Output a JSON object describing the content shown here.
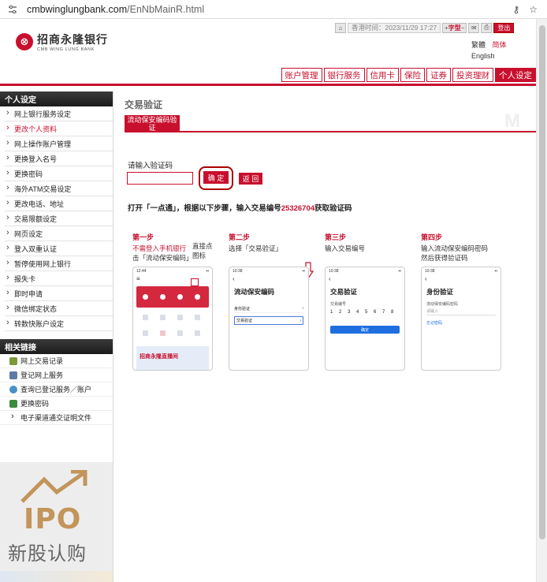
{
  "browser": {
    "url_host": "cmbwinglungbank.com",
    "url_path": "/EnNbMainR.html"
  },
  "header": {
    "logo_cn": "招商永隆银行",
    "logo_en": "CMB WING LUNG BANK",
    "time_label": "香港时间：2023/11/29 17:27",
    "font_label": "字型",
    "logout_label": "登出",
    "lang_trad": "繁體",
    "lang_simp": "简体",
    "lang_en": "English"
  },
  "nav_tabs": [
    {
      "label": "账户管理",
      "active": false
    },
    {
      "label": "银行服务",
      "active": false
    },
    {
      "label": "信用卡",
      "active": false
    },
    {
      "label": "保险",
      "active": false
    },
    {
      "label": "证券",
      "active": false
    },
    {
      "label": "投资理财",
      "active": false
    },
    {
      "label": "个人设定",
      "active": true
    }
  ],
  "sidebar": {
    "personal_header": "个人设定",
    "items": [
      {
        "label": "网上银行服务设定",
        "active": false
      },
      {
        "label": "更改个人资料",
        "active": true
      },
      {
        "label": "网上操作账户管理",
        "active": false
      },
      {
        "label": "更换登入名号",
        "active": false
      },
      {
        "label": "更换密码",
        "active": false
      },
      {
        "label": "海外ATM交易设定",
        "active": false
      },
      {
        "label": "更改电话、地址",
        "active": false
      },
      {
        "label": "交易限额设定",
        "active": false
      },
      {
        "label": "网页设定",
        "active": false
      },
      {
        "label": "登入双重认证",
        "active": false
      },
      {
        "label": "暂停使用网上银行",
        "active": false
      },
      {
        "label": "报失卡",
        "active": false
      },
      {
        "label": "即时申请",
        "active": false
      },
      {
        "label": "微信绑定状态",
        "active": false
      },
      {
        "label": "转数快账户设定",
        "active": false
      }
    ],
    "links_header": "相关链接",
    "links": [
      {
        "label": "网上交易记录",
        "icon": "notepad-icon",
        "color": "#7a9a3a"
      },
      {
        "label": "登记网上服务",
        "icon": "document-icon",
        "color": "#5c7ba8"
      },
      {
        "label": "查询已登记服务／账户",
        "icon": "magnifier-icon",
        "color": "#4a90c8"
      },
      {
        "label": "更换密码",
        "icon": "users-icon",
        "color": "#3d8a3d"
      },
      {
        "label": "电子渠道通交证明文件",
        "icon": "",
        "color": ""
      }
    ],
    "ipo_word": "IPO",
    "ipo_cn": "新股认购"
  },
  "main": {
    "page_title": "交易验证",
    "section_tab": "流动保安编码验证",
    "prompt_label": "请输入验证码",
    "input_value": "",
    "confirm_label": "确 定",
    "back_label": "返 回",
    "instruction_pre": "打开「一点通」，根据以下步骤，输入交易编号",
    "instruction_ref": "25326704",
    "instruction_post": "获取验证码",
    "steps": [
      {
        "title": "第一步",
        "desc_red": "不需登入手机银行",
        "desc": "击「流动保安编码」",
        "note": "直接点图标"
      },
      {
        "title": "第二步",
        "desc": "选择「交易验证」"
      },
      {
        "title": "第三步",
        "desc": "输入交易编号"
      },
      {
        "title": "第四步",
        "desc": "输入流动保安编码密码然后获得验证码"
      }
    ]
  },
  "phones": {
    "time": "12:44",
    "time2": "10:38",
    "p2_title": "流动保安编码",
    "p2_row1": "身份验证",
    "p2_row2": "交易验证",
    "p3_title": "交易验证",
    "p3_label": "交易编号",
    "p3_digits": "1 2 3 4 5 6 7 8",
    "p3_btn": "确定",
    "p4_title": "身份验证",
    "p4_label": "流动保安编码密码",
    "p4_input": "请输入",
    "p4_link": "忘记密码",
    "p1_promo": "招商永隆直播间"
  },
  "colors": {
    "brand_red": "#c8102e",
    "sidebar_dark": "#1b1b1b",
    "ipo_gold": "#c2955b"
  }
}
